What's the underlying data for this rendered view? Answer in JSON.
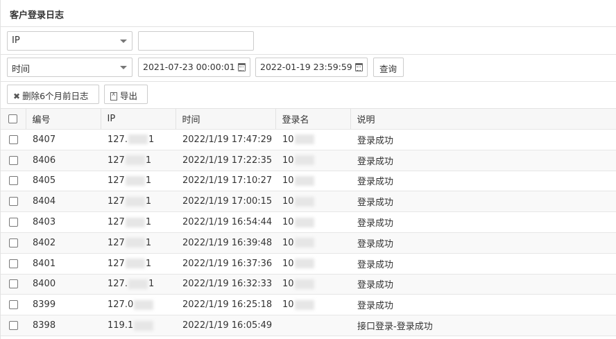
{
  "page": {
    "title": "客户登录日志"
  },
  "filters": {
    "field_select": "IP",
    "field_input": "",
    "time_select": "时间",
    "start_time": "2021-07-23 00:00:01",
    "end_time": "2022-01-19 23:59:59",
    "query_label": "查询"
  },
  "toolbar": {
    "delete_label": "删除6个月前日志",
    "export_label": "导出"
  },
  "table": {
    "columns": [
      "编号",
      "IP",
      "时间",
      "登录名",
      "说明"
    ],
    "rows": [
      {
        "id": "8407",
        "ip_prefix": "127.",
        "ip_suffix": "1",
        "time": "2022/1/19 17:47:29",
        "login": "10",
        "desc": "登录成功"
      },
      {
        "id": "8406",
        "ip_prefix": "127",
        "ip_suffix": "1",
        "time": "2022/1/19 17:22:35",
        "login": "10",
        "desc": "登录成功"
      },
      {
        "id": "8405",
        "ip_prefix": "127",
        "ip_suffix": "1",
        "time": "2022/1/19 17:10:27",
        "login": "10",
        "desc": "登录成功"
      },
      {
        "id": "8404",
        "ip_prefix": "127",
        "ip_suffix": "1",
        "time": "2022/1/19 17:00:15",
        "login": "10",
        "desc": "登录成功"
      },
      {
        "id": "8403",
        "ip_prefix": "127",
        "ip_suffix": "1",
        "time": "2022/1/19 16:54:44",
        "login": "10",
        "desc": "登录成功"
      },
      {
        "id": "8402",
        "ip_prefix": "127",
        "ip_suffix": "1",
        "time": "2022/1/19 16:39:48",
        "login": "10",
        "desc": "登录成功"
      },
      {
        "id": "8401",
        "ip_prefix": "127",
        "ip_suffix": "1",
        "time": "2022/1/19 16:37:36",
        "login": "10",
        "desc": "登录成功"
      },
      {
        "id": "8400",
        "ip_prefix": "127.",
        "ip_suffix": "1",
        "time": "2022/1/19 16:32:33",
        "login": "10",
        "desc": "登录成功"
      },
      {
        "id": "8399",
        "ip_prefix": "127.0",
        "ip_suffix": "",
        "time": "2022/1/19 16:25:18",
        "login": "10",
        "desc": "登录成功"
      },
      {
        "id": "8398",
        "ip_prefix": "119.1",
        "ip_suffix": "",
        "time": "2022/1/19 16:05:49",
        "login": "",
        "desc": "接口登录-登录成功"
      }
    ]
  }
}
